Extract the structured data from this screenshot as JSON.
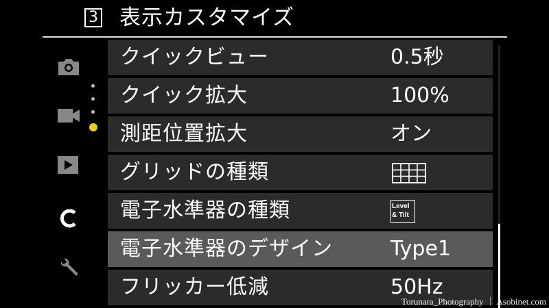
{
  "header": {
    "page_number": "3",
    "title": "表示カスタマイズ"
  },
  "sidebar": {
    "tabs": [
      {
        "id": "shooting",
        "icon": "camera-icon"
      },
      {
        "id": "movie",
        "icon": "video-camera-icon"
      },
      {
        "id": "playback",
        "icon": "play-icon"
      },
      {
        "id": "custom",
        "icon": "custom-c-icon",
        "active": true
      },
      {
        "id": "setup",
        "icon": "wrench-icon"
      }
    ],
    "page_dots": 4,
    "active_dot": 4
  },
  "menu": {
    "items": [
      {
        "label": "クイックビュー",
        "value": "0.5秒"
      },
      {
        "label": "クイック拡大",
        "value": "100%"
      },
      {
        "label": "測距位置拡大",
        "value": "オン"
      },
      {
        "label": "グリッドの種類",
        "value_icon": "grid-icon"
      },
      {
        "label": "電子水準器の種類",
        "value_icon": "level-tilt-icon",
        "value_icon_text": [
          "Level",
          "& Tilt"
        ]
      },
      {
        "label": "電子水準器のデザイン",
        "value": "Type1",
        "selected": true
      },
      {
        "label": "フリッカー低減",
        "value": "50Hz"
      }
    ]
  },
  "scrollbar": {
    "position": 0.68
  },
  "watermark": "Torunara_Photography ｜ Asobinet.com",
  "colors": {
    "accent_dot": "#f2d000",
    "row_bg": "#2b2b2b",
    "row_selected_bg": "#5a5a5a"
  }
}
